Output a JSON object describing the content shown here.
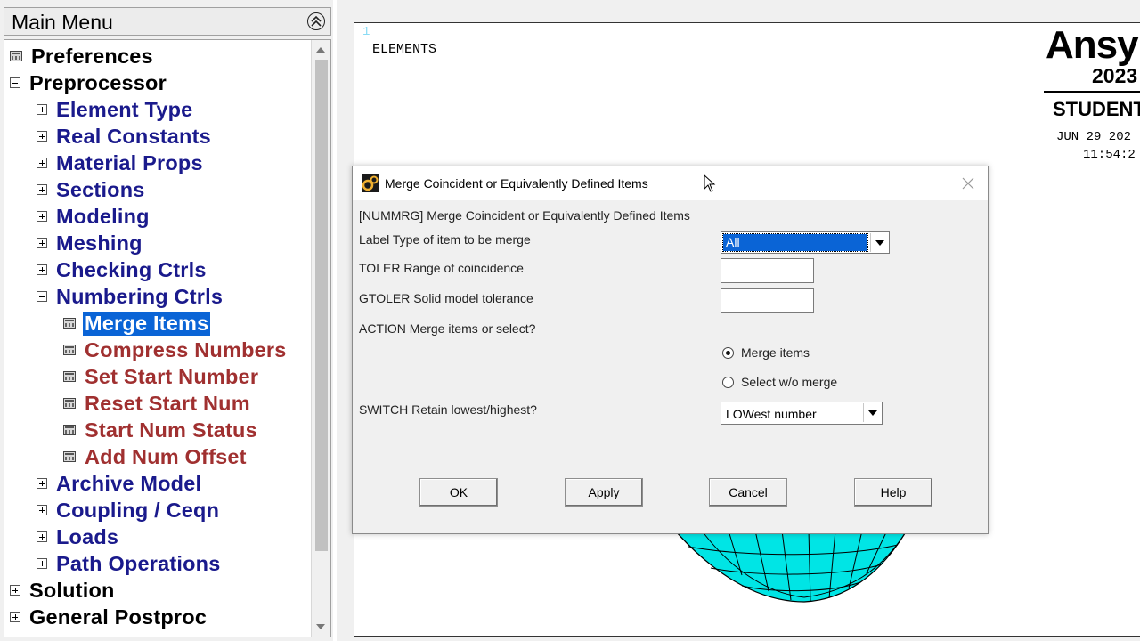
{
  "menu": {
    "title": "Main Menu",
    "items": [
      {
        "label": "Preferences",
        "level": 0,
        "icon": "leaf"
      },
      {
        "label": "Preprocessor",
        "level": 0,
        "icon": "minus"
      },
      {
        "label": "Element Type",
        "level": 1,
        "icon": "plus"
      },
      {
        "label": "Real Constants",
        "level": 1,
        "icon": "plus"
      },
      {
        "label": "Material Props",
        "level": 1,
        "icon": "plus"
      },
      {
        "label": "Sections",
        "level": 1,
        "icon": "plus"
      },
      {
        "label": "Modeling",
        "level": 1,
        "icon": "plus"
      },
      {
        "label": "Meshing",
        "level": 1,
        "icon": "plus"
      },
      {
        "label": "Checking Ctrls",
        "level": 1,
        "icon": "plus"
      },
      {
        "label": "Numbering Ctrls",
        "level": 1,
        "icon": "minus"
      },
      {
        "label": "Merge Items",
        "level": 2,
        "icon": "leaf",
        "selected": true
      },
      {
        "label": "Compress Numbers",
        "level": 2,
        "icon": "leaf"
      },
      {
        "label": "Set Start Number",
        "level": 2,
        "icon": "leaf"
      },
      {
        "label": "Reset Start Num",
        "level": 2,
        "icon": "leaf"
      },
      {
        "label": "Start Num Status",
        "level": 2,
        "icon": "leaf"
      },
      {
        "label": "Add Num Offset",
        "level": 2,
        "icon": "leaf"
      },
      {
        "label": "Archive Model",
        "level": 1,
        "icon": "plus"
      },
      {
        "label": "Coupling / Ceqn",
        "level": 1,
        "icon": "plus"
      },
      {
        "label": "Loads",
        "level": 1,
        "icon": "plus"
      },
      {
        "label": "Path Operations",
        "level": 1,
        "icon": "plus"
      },
      {
        "label": "Solution",
        "level": 0,
        "icon": "plus"
      },
      {
        "label": "General Postproc",
        "level": 0,
        "icon": "plus"
      }
    ]
  },
  "graphics": {
    "window_number": "1",
    "label": "ELEMENTS",
    "logo": "Ansy",
    "year": "2023",
    "edition": "STUDENT",
    "date": "JUN 29 202",
    "time": "11:54:2",
    "mesh_color": "#00e5e5"
  },
  "dialog": {
    "title": "Merge Coincident or Equivalently Defined Items",
    "command_line": "[NUMMRG]  Merge Coincident or Equivalently Defined Items",
    "label_field": "Label   Type of item to be merge",
    "label_value": "All",
    "toler_field": "TOLER   Range of coincidence",
    "toler_value": "",
    "gtoler_field": "GTOLER  Solid model tolerance",
    "gtoler_value": "",
    "action_field": "ACTION  Merge items or select?",
    "action_options": [
      "Merge items",
      "Select w/o merge"
    ],
    "switch_field": "SWITCH  Retain lowest/highest?",
    "switch_value": "LOWest number",
    "buttons": {
      "ok": "OK",
      "apply": "Apply",
      "cancel": "Cancel",
      "help": "Help"
    },
    "selection_color": "#0a64d6"
  }
}
